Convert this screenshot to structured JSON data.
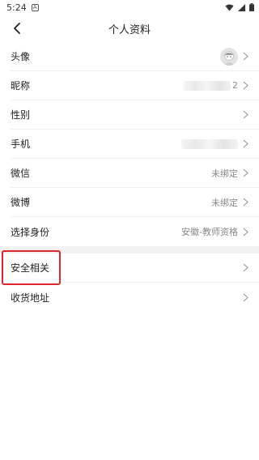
{
  "status_bar": {
    "time": "5:24",
    "notification_icon": "a-notification-icon",
    "icons": [
      "wifi-icon",
      "signal-icon",
      "battery-icon"
    ]
  },
  "header": {
    "title": "个人资料",
    "back_icon": "chevron-left-icon"
  },
  "rows": {
    "avatar": {
      "label": "头像"
    },
    "nickname": {
      "label": "昵称",
      "value_partial": "2"
    },
    "gender": {
      "label": "性别"
    },
    "phone": {
      "label": "手机"
    },
    "wechat": {
      "label": "微信",
      "value": "未绑定"
    },
    "weibo": {
      "label": "微博",
      "value": "未绑定"
    },
    "identity": {
      "label": "选择身份",
      "value": "安徽-教师资格"
    },
    "security": {
      "label": "安全相关"
    },
    "address": {
      "label": "收货地址"
    }
  },
  "colors": {
    "highlight_border": "#e0262a",
    "divider": "#efefef",
    "section_gap": "#f2f2f2",
    "value_text": "#888888"
  }
}
